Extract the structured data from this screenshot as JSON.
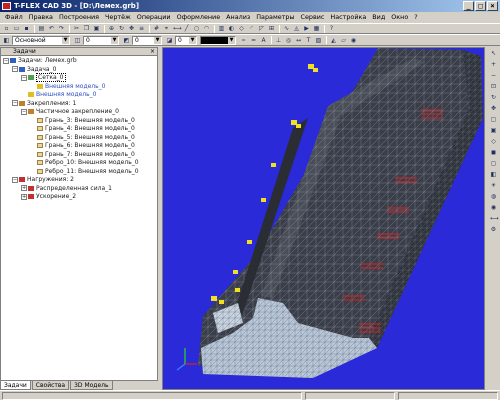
{
  "window": {
    "title": "T-FLEX CAD 3D - [D:\\Лемех.grb]",
    "buttons": [
      "_",
      "□",
      "×"
    ]
  },
  "menu": [
    "Файл",
    "Правка",
    "Построения",
    "Чертёж",
    "Операции",
    "Оформление",
    "Анализ",
    "Параметры",
    "Сервис",
    "Настройка",
    "Вид",
    "Окно",
    "?"
  ],
  "toolbar2": {
    "style_combo": "Основной",
    "field_a": "0",
    "field_b": "0",
    "field_c": "0"
  },
  "panel": {
    "header": "Задачи",
    "close": "×",
    "tree": [
      {
        "toggle": "−",
        "icon": "task",
        "label": "Задачи: Лемех.grb",
        "indent": 0
      },
      {
        "toggle": "−",
        "icon": "task",
        "label": "Задача_0",
        "indent": 1
      },
      {
        "toggle": "−",
        "icon": "mesh",
        "label": "Сетка_0",
        "indent": 2,
        "selected": true
      },
      {
        "toggle": "",
        "icon": "model",
        "label": "Внешняя модель_0",
        "indent": 3,
        "link": true
      },
      {
        "toggle": "",
        "icon": "model",
        "label": "Внешняя модель_0",
        "indent": 2,
        "link": true
      },
      {
        "toggle": "−",
        "icon": "fix",
        "label": "Закрепления: 1",
        "indent": 1
      },
      {
        "toggle": "−",
        "icon": "fix",
        "label": "Частичное закрепление_0",
        "indent": 2
      },
      {
        "toggle": "",
        "icon": "face",
        "label": "Грань_3: Внешняя модель_0",
        "indent": 3
      },
      {
        "toggle": "",
        "icon": "face",
        "label": "Грань_4: Внешняя модель_0",
        "indent": 3
      },
      {
        "toggle": "",
        "icon": "face",
        "label": "Грань_5: Внешняя модель_0",
        "indent": 3
      },
      {
        "toggle": "",
        "icon": "face",
        "label": "Грань_6: Внешняя модель_0",
        "indent": 3
      },
      {
        "toggle": "",
        "icon": "face",
        "label": "Грань_7: Внешняя модель_0",
        "indent": 3
      },
      {
        "toggle": "",
        "icon": "face",
        "label": "Ребро_10: Внешняя модель_0",
        "indent": 3
      },
      {
        "toggle": "",
        "icon": "face",
        "label": "Ребро_11: Внешняя модель_0",
        "indent": 3
      },
      {
        "toggle": "−",
        "icon": "load",
        "label": "Нагружения: 2",
        "indent": 1
      },
      {
        "toggle": "+",
        "icon": "load",
        "label": "Распределенная сила_1",
        "indent": 2
      },
      {
        "toggle": "+",
        "icon": "load",
        "label": "Ускорение_2",
        "indent": 2
      }
    ],
    "tabs": [
      "Задачи",
      "Свойства",
      "3D Модель"
    ]
  },
  "colors": {
    "viewport_bg": "#2a2ad8",
    "mesh_dark": "#3a3e48",
    "mesh_light": "#b8c8d8",
    "mesh_line": "#8a92a0",
    "load_arrow": "#e02020",
    "fix_marker": "#f0e020"
  },
  "icons": {
    "toolbar1": [
      "new-icon",
      "open-icon",
      "save-icon",
      "print-icon",
      "undo-icon",
      "redo-icon",
      "cut-icon",
      "copy-icon",
      "paste-icon",
      "zoom-icon",
      "rotate-icon",
      "pan-icon",
      "layers-icon",
      "grid-icon",
      "snap-icon",
      "help-icon"
    ],
    "right": [
      "select-icon",
      "zoom-in-icon",
      "zoom-out-icon",
      "fit-icon",
      "rotate-icon",
      "pan-icon",
      "view-front-icon",
      "view-top-icon",
      "view-iso-icon",
      "shade-icon",
      "wire-icon",
      "section-icon",
      "light-icon",
      "material-icon",
      "render-icon",
      "measure-icon",
      "settings-icon"
    ]
  }
}
